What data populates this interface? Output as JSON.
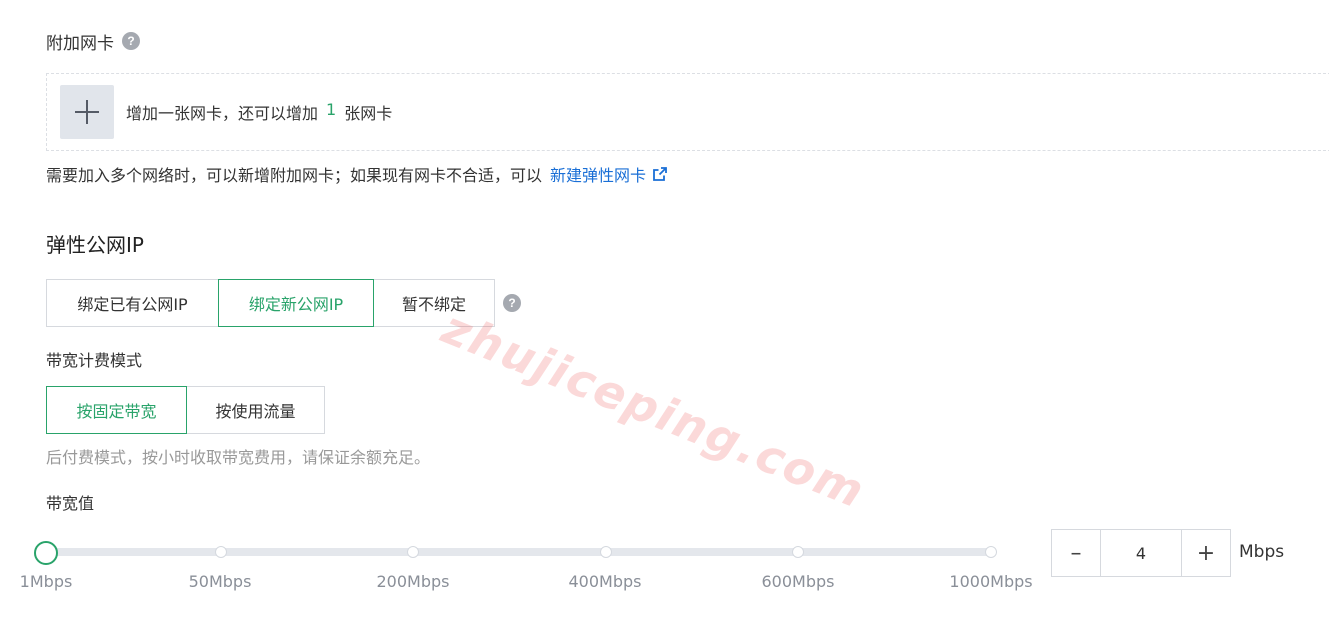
{
  "nic": {
    "label": "附加网卡",
    "add_prefix": "增加一张网卡，还可以增加",
    "remaining": "1",
    "add_suffix": "张网卡",
    "hint": "需要加入多个网络时，可以新增附加网卡；如果现有网卡不合适，可以",
    "link": "新建弹性网卡"
  },
  "eip": {
    "title": "弹性公网IP",
    "options": [
      "绑定已有公网IP",
      "绑定新公网IP",
      "暂不绑定"
    ],
    "selected": "绑定新公网IP"
  },
  "billing": {
    "label": "带宽计费模式",
    "options": [
      "按固定带宽",
      "按使用流量"
    ],
    "selected": "按固定带宽",
    "hint": "后付费模式，按小时收取带宽费用，请保证余额充足。"
  },
  "bandwidth": {
    "label": "带宽值",
    "ticks": [
      "1Mbps",
      "50Mbps",
      "200Mbps",
      "400Mbps",
      "600Mbps",
      "1000Mbps"
    ],
    "value": "4",
    "unit": "Mbps",
    "minus": "–",
    "plus": "+"
  },
  "watermark": "zhujiceping.com",
  "help_glyph": "?",
  "colors": {
    "accent": "#29a36a",
    "link": "#1a6fd6"
  }
}
